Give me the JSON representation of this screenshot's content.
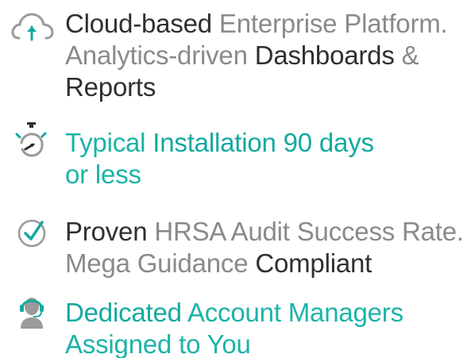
{
  "features": [
    {
      "icon": "cloud-upload-icon",
      "parts": [
        {
          "style": "strong",
          "text": "Cloud-based"
        },
        {
          "style": "light",
          "text": " Enterprise Platform. Analytics-driven "
        },
        {
          "style": "strong",
          "text": "Dashboards"
        },
        {
          "style": "light",
          "text": " & "
        },
        {
          "style": "strong",
          "text": "Reports"
        }
      ]
    },
    {
      "icon": "stopwatch-icon",
      "parts": [
        {
          "style": "light",
          "text": "Typical "
        },
        {
          "style": "strong",
          "text": "Installation 90 days"
        },
        {
          "style": "light",
          "text": " or less"
        }
      ]
    },
    {
      "icon": "check-circle-icon",
      "parts": [
        {
          "style": "strong",
          "text": "Proven"
        },
        {
          "style": "light",
          "text": " HRSA Audit Success Rate. Mega Guidance "
        },
        {
          "style": "strong",
          "text": "Compliant"
        }
      ]
    },
    {
      "icon": "headset-agent-icon",
      "parts": [
        {
          "style": "strong",
          "text": "Dedicated"
        },
        {
          "style": "light",
          "text": " Account Managers Assigned to You"
        }
      ]
    }
  ],
  "colors": {
    "dark_text": "#2f2f2f",
    "light_text": "#8a8a8a",
    "teal": "#13a99f",
    "icon_gray": "#9a9a9a"
  }
}
